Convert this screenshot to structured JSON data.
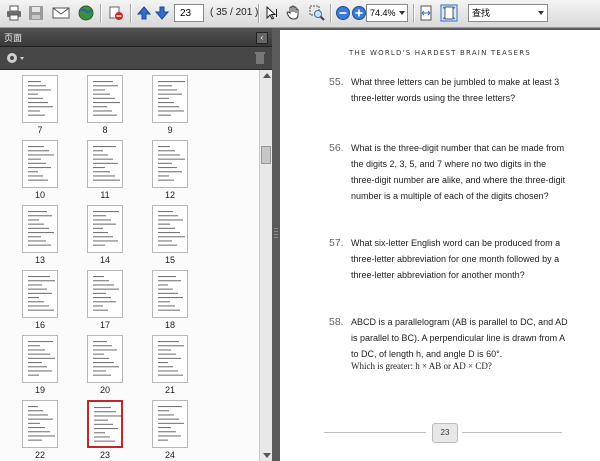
{
  "toolbar": {
    "page_input": "23",
    "page_count": "( 35 / 201 )",
    "zoom": "74.4%",
    "search_value": "查找"
  },
  "panel": {
    "title": "页面"
  },
  "thumbnails": [
    {
      "label": "7"
    },
    {
      "label": "8"
    },
    {
      "label": "9"
    },
    {
      "label": "10"
    },
    {
      "label": "11"
    },
    {
      "label": "12"
    },
    {
      "label": "13"
    },
    {
      "label": "14"
    },
    {
      "label": "15"
    },
    {
      "label": "16"
    },
    {
      "label": "17"
    },
    {
      "label": "18"
    },
    {
      "label": "19"
    },
    {
      "label": "20"
    },
    {
      "label": "21"
    },
    {
      "label": "22"
    },
    {
      "label": "23"
    },
    {
      "label": "24"
    }
  ],
  "document": {
    "running_head": "THE WORLD'S HARDEST BRAIN TEASERS",
    "questions": [
      {
        "number": "55.",
        "text": "What three letters can be jumbled to make at least 3 three-letter words using the three letters?"
      },
      {
        "number": "56.",
        "text": "What is the three-digit number that can be made from the digits 2, 3, 5, and 7 where no two digits in the three-digit number are alike, and where the three-digit number is a multiple of each of the digits chosen?"
      },
      {
        "number": "57.",
        "text": "What six-letter English word can be produced from a three-letter abbreviation for one month followed by a three-letter abbreviation for another month?"
      },
      {
        "number": "58.",
        "text": "ABCD is a parallelogram (AB is parallel to DC, and AD is parallel to BC). A perpendicular line is drawn from A to DC, of length h, and angle D is 60°."
      }
    ],
    "q58_extra": "Which is greater: h × AB or AD × CD?",
    "page_number": "23"
  },
  "colors": {
    "selected_thumb_border": "#c0262c",
    "toolbar_blue": "#2f6fc8"
  }
}
